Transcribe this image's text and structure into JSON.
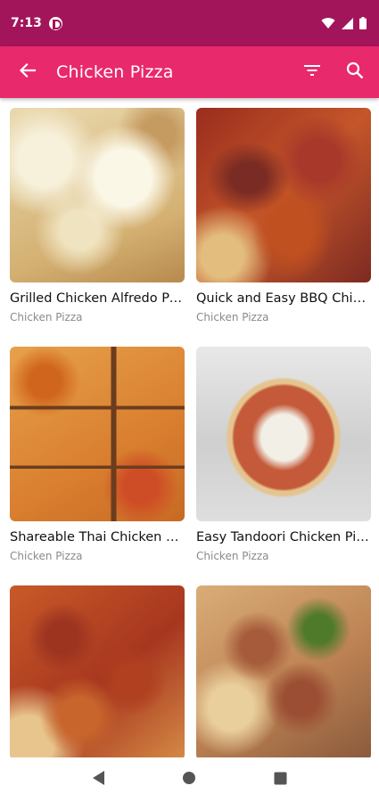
{
  "status_bar": {
    "time": "7:13"
  },
  "app_bar": {
    "title": "Chicken Pizza",
    "color": "#e8296c",
    "status_color": "#a3155a",
    "icons": [
      "arrow-back-icon",
      "filter-icon",
      "search-icon"
    ]
  },
  "recipes": [
    {
      "title": "Grilled Chicken Alfredo Pizza",
      "category": "Chicken Pizza"
    },
    {
      "title": "Quick and Easy BBQ Chicken Pizza",
      "category": "Chicken Pizza"
    },
    {
      "title": "Shareable Thai Chicken Pizza",
      "category": "Chicken Pizza"
    },
    {
      "title": "Easy Tandoori Chicken Pizza",
      "category": "Chicken Pizza"
    },
    {
      "title": "",
      "category": ""
    },
    {
      "title": "",
      "category": ""
    }
  ],
  "nav_bar": {
    "icons": [
      "back-triangle-icon",
      "home-circle-icon",
      "recents-square-icon"
    ]
  }
}
